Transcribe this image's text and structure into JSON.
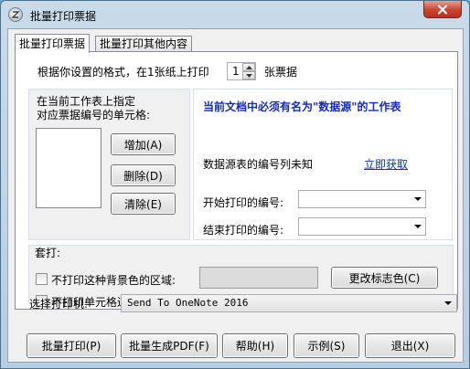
{
  "window": {
    "title": "批量打印票据",
    "icon": "app-logo-icon",
    "close_icon": "close-icon"
  },
  "tabs": [
    {
      "label": "批量打印票据",
      "active": true
    },
    {
      "label": "批量打印其他内容",
      "active": false
    }
  ],
  "copies": {
    "prefix": "根据你设置的格式，在1张纸上打印",
    "value": "1",
    "suffix": "张票据"
  },
  "cell_selector": {
    "label_line1": "在当前工作表上指定",
    "label_line2": "对应票据编号的单元格:",
    "add_button": "增加(A)",
    "delete_button": "删除(D)",
    "clear_button": "清除(E)"
  },
  "data_source": {
    "title": "当前文档中必须有名为\"数据源\"的工作表",
    "status_text": "数据源表的编号列未知",
    "fetch_link": "立即获取",
    "start_label": "开始打印的编号:",
    "start_value": "",
    "end_label": "结束打印的编号:",
    "end_value": ""
  },
  "overprint": {
    "group_label": "套打:",
    "no_bg_color_label": "不打印这种背景色的区域:",
    "no_bg_color_checked": false,
    "change_color_button": "更改标志色(C)",
    "swatch_color": "#dcdcdc",
    "no_border_label": "不打印单元格边框线",
    "no_border_checked": false
  },
  "printer": {
    "label": "选择打印机:",
    "selected": "Send To OneNote 2016"
  },
  "footer": {
    "batch_print": "批量打印(P)",
    "batch_pdf": "批量生成PDF(F)",
    "help": "帮助(H)",
    "example": "示例(S)",
    "exit": "退出(X)"
  },
  "colors": {
    "title_accent": "#1328c8",
    "link": "#0033cc",
    "close_button": "#c9432f"
  }
}
